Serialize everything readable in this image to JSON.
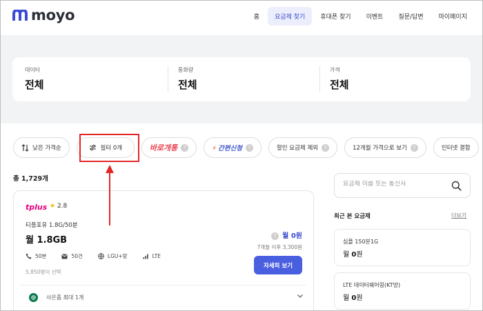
{
  "header": {
    "logo_text": "moyo",
    "brand_color": "#3b4bd6",
    "nav": [
      {
        "label": "홈",
        "active": false
      },
      {
        "label": "요금제 찾기",
        "active": true
      },
      {
        "label": "휴대폰 찾기",
        "active": false
      },
      {
        "label": "이벤트",
        "active": false
      },
      {
        "label": "질문/답변",
        "active": false
      },
      {
        "label": "마이페이지",
        "active": false
      }
    ]
  },
  "summary": [
    {
      "label": "데이터",
      "value": "전체"
    },
    {
      "label": "통화량",
      "value": "전체"
    },
    {
      "label": "가격",
      "value": "전체"
    }
  ],
  "chips": {
    "sort": "낮은 가격순",
    "filter": "필터 0개",
    "baro": "바로개통",
    "easy": "간편신청",
    "exclude_discount": "할인 요금제 제외",
    "twelve_month": "12개월 가격으로 보기",
    "internet": "인터넷 결합"
  },
  "list": {
    "total": "총 1,729개",
    "plan": {
      "carrier": "tplus",
      "rating": "2.8",
      "name": "티플포유 1.8G/50분",
      "data": "월 1.8GB",
      "price": "월 0원",
      "price_after": "7개월 이후 3,300원",
      "specs": {
        "call": "50분",
        "sms": "50건",
        "network": "LGU+망",
        "type": "LTE"
      },
      "picked": "5,850명이 선택",
      "detail_button": "자세히 보기",
      "gift": "사은품 최대 1개"
    }
  },
  "sidebar": {
    "search_placeholder": "요금제 이름 또는 통신사",
    "recent_title": "최근 본 요금제",
    "more": "더보기",
    "recent": [
      {
        "name": "심플 150분1G",
        "price_prefix": "월 ",
        "price_value": "0",
        "price_suffix": "원"
      },
      {
        "name": "LTE 데이터쉐어링(KT망)",
        "price_prefix": "월 ",
        "price_value": "0",
        "price_suffix": "원"
      }
    ]
  },
  "colors": {
    "accent": "#4a5fe0",
    "annotation": "#e22626"
  }
}
